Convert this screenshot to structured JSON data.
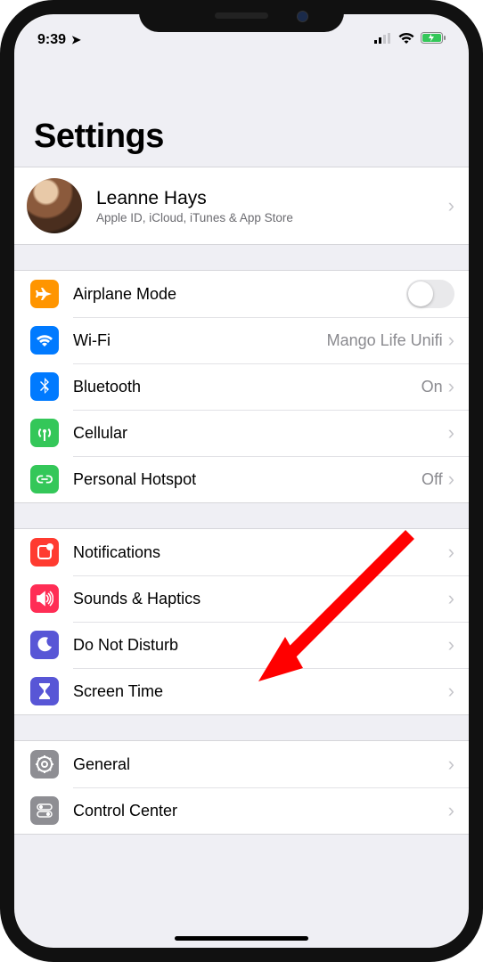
{
  "status": {
    "time": "9:39",
    "location_glyph": "➤"
  },
  "page_title": "Settings",
  "profile": {
    "name": "Leanne Hays",
    "subtitle": "Apple ID, iCloud, iTunes & App Store"
  },
  "groups": [
    {
      "rows": [
        {
          "id": "airplane",
          "label": "Airplane Mode",
          "icon": "airplane",
          "color": "#ff9500",
          "control": "toggle",
          "toggled": false
        },
        {
          "id": "wifi",
          "label": "Wi-Fi",
          "icon": "wifi",
          "color": "#007aff",
          "value": "Mango Life Unifi"
        },
        {
          "id": "bluetooth",
          "label": "Bluetooth",
          "icon": "bluetooth",
          "color": "#007aff",
          "value": "On"
        },
        {
          "id": "cellular",
          "label": "Cellular",
          "icon": "antenna",
          "color": "#34c759"
        },
        {
          "id": "hotspot",
          "label": "Personal Hotspot",
          "icon": "link",
          "color": "#34c759",
          "value": "Off"
        }
      ]
    },
    {
      "rows": [
        {
          "id": "notifications",
          "label": "Notifications",
          "icon": "bell",
          "color": "#ff3b30"
        },
        {
          "id": "sounds",
          "label": "Sounds & Haptics",
          "icon": "speaker",
          "color": "#ff2d55"
        },
        {
          "id": "dnd",
          "label": "Do Not Disturb",
          "icon": "moon",
          "color": "#5856d6"
        },
        {
          "id": "screentime",
          "label": "Screen Time",
          "icon": "hourglass",
          "color": "#5856d6"
        }
      ]
    },
    {
      "rows": [
        {
          "id": "general",
          "label": "General",
          "icon": "gear",
          "color": "#8e8e93"
        },
        {
          "id": "controlcenter",
          "label": "Control Center",
          "icon": "toggles",
          "color": "#8e8e93"
        }
      ]
    }
  ]
}
